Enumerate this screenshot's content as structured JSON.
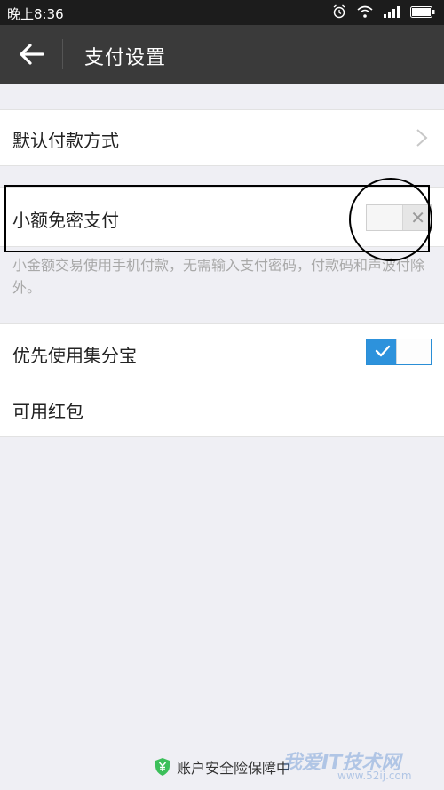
{
  "status_bar": {
    "time": "晚上8:36",
    "icons": [
      "alarm-icon",
      "wifi-icon",
      "signal-icon",
      "battery-icon"
    ]
  },
  "header": {
    "title": "支付设置",
    "back_icon": "back-arrow-icon"
  },
  "settings": {
    "default_payment": {
      "label": "默认付款方式"
    },
    "small_amount": {
      "label": "小额免密支付",
      "enabled": false,
      "description": "小金额交易使用手机付款，无需输入支付密码，付款码和声波付除外。"
    },
    "jifenbao": {
      "label": "优先使用集分宝",
      "enabled": true
    },
    "hongbao": {
      "label": "可用红包"
    }
  },
  "footer": {
    "text": "账户安全险保障中",
    "icon": "shield-yen-icon"
  },
  "watermark": {
    "text": "我爱IT技术网",
    "url": "www.52ij.com"
  },
  "colors": {
    "toggle_on": "#2d92dc",
    "shield": "#3cbf5a",
    "title_bar": "#3a3a3a"
  }
}
